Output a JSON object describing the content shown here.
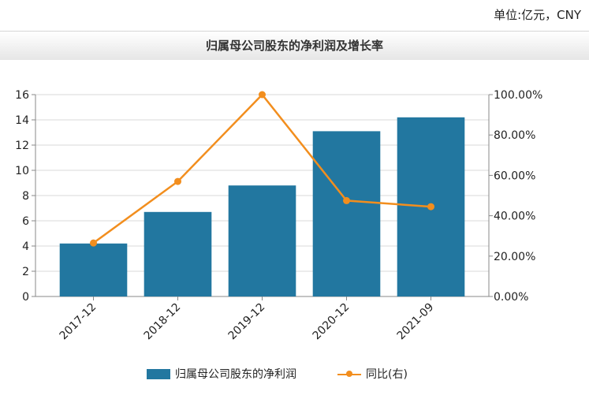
{
  "unit_label": "单位:亿元，CNY",
  "chart_data": {
    "type": "bar",
    "title": "归属母公司股东的净利润及增长率",
    "categories": [
      "2017-12",
      "2018-12",
      "2019-12",
      "2020-12",
      "2021-09"
    ],
    "series": [
      {
        "name": "归属母公司股东的净利润",
        "type": "bar",
        "axis": "left",
        "color": "#2277a0",
        "values": [
          4.2,
          6.7,
          8.8,
          13.1,
          14.2
        ]
      },
      {
        "name": "同比(右)",
        "type": "line",
        "axis": "right",
        "color": "#f28e1e",
        "values": [
          26.5,
          57.0,
          100.0,
          47.5,
          44.5
        ]
      }
    ],
    "y_left": {
      "range": [
        0,
        16
      ],
      "ticks": [
        "0",
        "2",
        "4",
        "6",
        "8",
        "10",
        "12",
        "14",
        "16"
      ]
    },
    "y_right": {
      "range": [
        0,
        100
      ],
      "ticks": [
        "0.00%",
        "20.00%",
        "40.00%",
        "60.00%",
        "80.00%",
        "100.00%"
      ]
    },
    "grid": true,
    "legend": "bottom"
  }
}
